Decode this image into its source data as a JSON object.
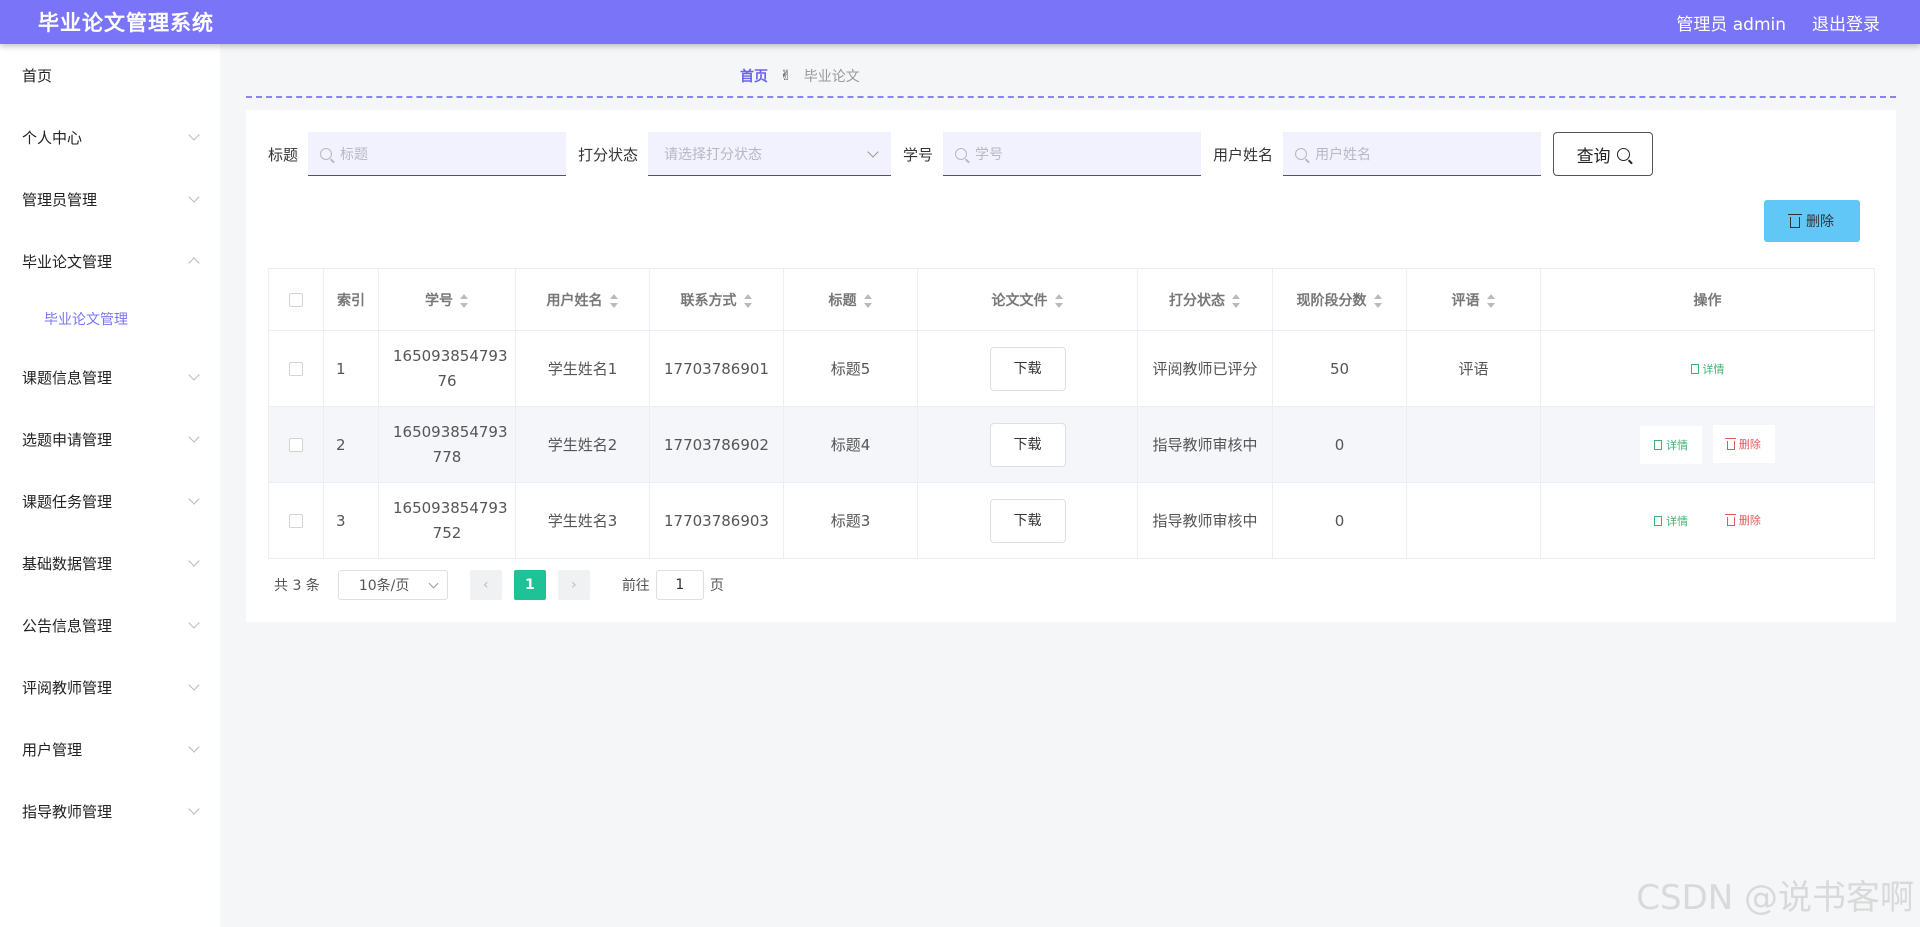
{
  "header": {
    "title": "毕业论文管理系统",
    "user": "管理员 admin",
    "logout": "退出登录"
  },
  "sidebar": {
    "items": [
      {
        "label": "首页"
      },
      {
        "label": "个人中心"
      },
      {
        "label": "管理员管理"
      },
      {
        "label": "毕业论文管理"
      },
      {
        "label": "课题信息管理"
      },
      {
        "label": "选题申请管理"
      },
      {
        "label": "课题任务管理"
      },
      {
        "label": "基础数据管理"
      },
      {
        "label": "公告信息管理"
      },
      {
        "label": "评阅教师管理"
      },
      {
        "label": "用户管理"
      },
      {
        "label": "指导教师管理"
      }
    ],
    "sub_item": "毕业论文管理"
  },
  "breadcrumb": {
    "home": "首页",
    "separator": "✌",
    "current": "毕业论文"
  },
  "search": {
    "title_label": "标题",
    "title_placeholder": "标题",
    "status_label": "打分状态",
    "status_placeholder": "请选择打分状态",
    "student_no_label": "学号",
    "student_no_placeholder": "学号",
    "username_label": "用户姓名",
    "username_placeholder": "用户姓名",
    "query_button": "查询"
  },
  "toolbar": {
    "delete_button": "删除"
  },
  "table": {
    "headers": [
      "索引",
      "学号",
      "用户姓名",
      "联系方式",
      "标题",
      "论文文件",
      "打分状态",
      "现阶段分数",
      "评语",
      "操作"
    ],
    "rows": [
      {
        "index": "1",
        "student_no": "165093854793 76",
        "name": "学生姓名1",
        "phone": "17703786901",
        "title": "标题5",
        "file_button": "下载",
        "status": "评阅教师已评分",
        "score": "50",
        "comment": "评语",
        "detail": "详情",
        "delete": ""
      },
      {
        "index": "2",
        "student_no": "165093854793 778",
        "name": "学生姓名2",
        "phone": "17703786902",
        "title": "标题4",
        "file_button": "下载",
        "status": "指导教师审核中",
        "score": "0",
        "comment": "",
        "detail": "详情",
        "delete": "删除"
      },
      {
        "index": "3",
        "student_no": "165093854793 752",
        "name": "学生姓名3",
        "phone": "17703786903",
        "title": "标题3",
        "file_button": "下载",
        "status": "指导教师审核中",
        "score": "0",
        "comment": "",
        "detail": "详情",
        "delete": "删除"
      }
    ]
  },
  "pagination": {
    "total": "共 3 条",
    "page_size": "10条/页",
    "current_page": "1",
    "goto_prefix": "前往",
    "goto_value": "1",
    "goto_suffix": "页"
  },
  "watermark": "CSDN @说书客啊",
  "colors": {
    "header": "#7a74f8",
    "accent": "#6a63f0",
    "delete_button": "#61c7f6",
    "active_page": "#1fc197"
  }
}
